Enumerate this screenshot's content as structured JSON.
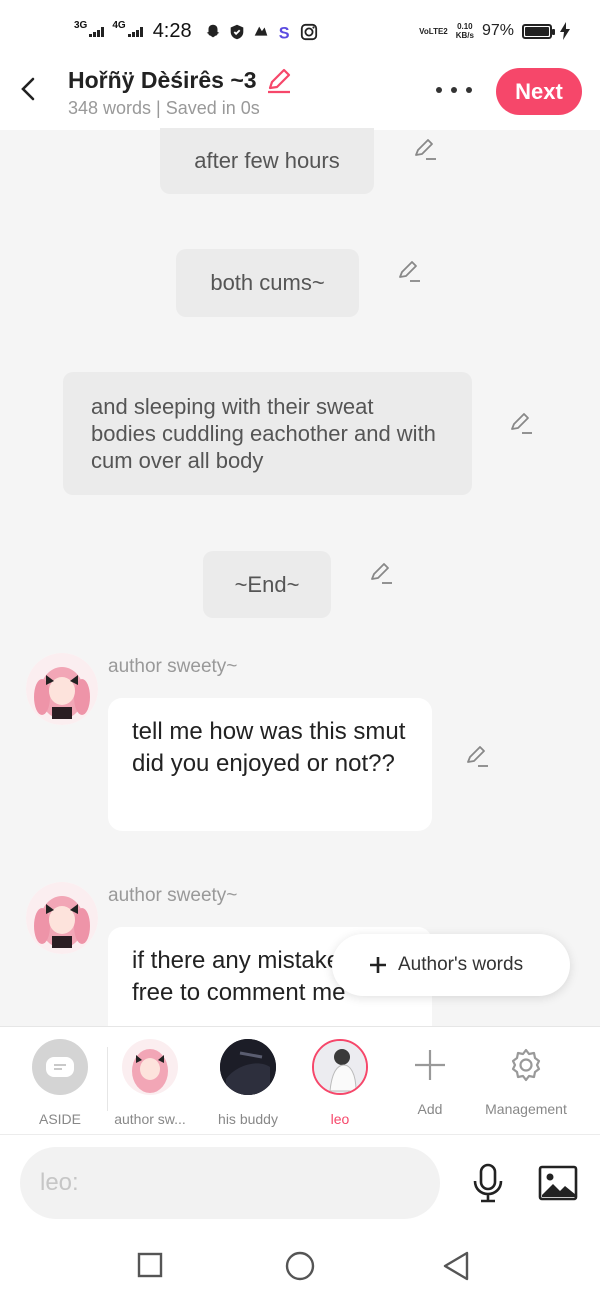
{
  "status_bar": {
    "network_1": "3G",
    "network_2": "4G",
    "time": "4:28",
    "volte": "VoLTE2",
    "speed_value": "0.10",
    "speed_unit": "KB/s",
    "battery": "97%",
    "icons": [
      "snapchat-icon",
      "shield-icon",
      "vpn-icon",
      "s-app-icon",
      "instagram-icon",
      "charging-icon"
    ]
  },
  "header": {
    "title": "Hořñÿ Dèśirês ~3",
    "subtitle": "348 words | Saved in 0s",
    "next_label": "Next",
    "accent_color": "#f6476a"
  },
  "chat": {
    "narrations": [
      {
        "text": "after few hours"
      },
      {
        "text": "both cums~"
      },
      {
        "text": "and sleeping with their sweat bodies cuddling eachother and with cum over all body"
      },
      {
        "text": "~End~"
      }
    ],
    "messages": [
      {
        "author": "author sweety~",
        "text": "tell me how was this smut did you enjoyed or not??"
      },
      {
        "author": "author sweety~",
        "text": "if there any mistake feel free to comment me"
      }
    ],
    "fab_label": "Author's words"
  },
  "characters": {
    "items": [
      {
        "label": "ASIDE"
      },
      {
        "label": "author sw..."
      },
      {
        "label": "his buddy"
      },
      {
        "label": "leo"
      },
      {
        "label": "Add"
      },
      {
        "label": "Management"
      }
    ],
    "active": "leo"
  },
  "composer": {
    "placeholder": "leo:"
  }
}
